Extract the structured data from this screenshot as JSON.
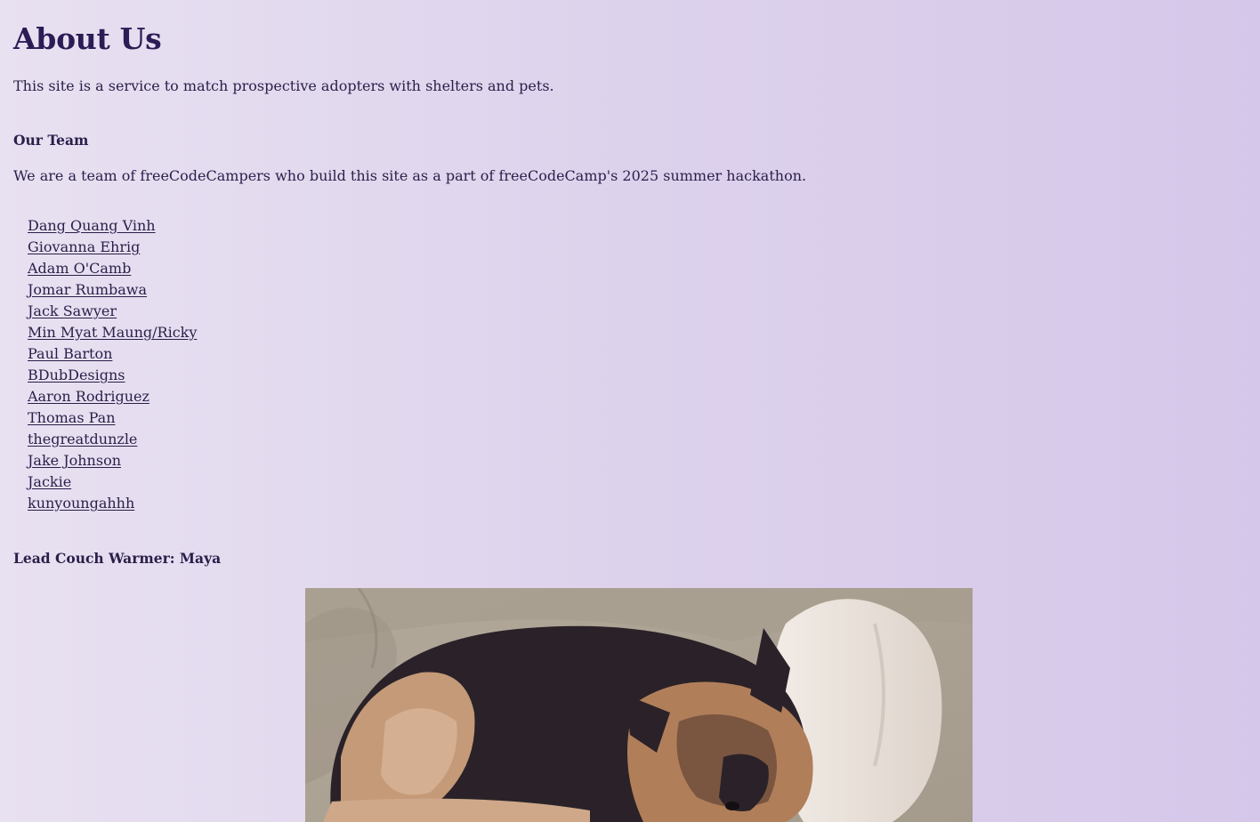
{
  "page": {
    "title": "About Us",
    "intro": "This site is a service to match prospective adopters with shelters and pets."
  },
  "team": {
    "heading": "Our Team",
    "description": "We are a team of freeCodeCampers who build this site as a part of freeCodeCamp's 2025 summer hackathon.",
    "members": [
      "Dang Quang Vinh",
      "Giovanna Ehrig",
      "Adam O'Camb",
      "Jomar Rumbawa",
      "Jack Sawyer",
      "Min Myat Maung/Ricky",
      "Paul Barton",
      "BDubDesigns",
      "Aaron Rodriguez",
      "Thomas Pan",
      "thegreatdunzle",
      "Jake Johnson",
      "Jackie",
      "kunyoungahhh"
    ]
  },
  "couch_warmer": {
    "heading": "Lead Couch Warmer: Maya"
  },
  "colors": {
    "text": "#2a1f4a",
    "heading": "#2b1c55",
    "background_start": "#e8e1f1",
    "background_end": "#d5c7e9"
  }
}
